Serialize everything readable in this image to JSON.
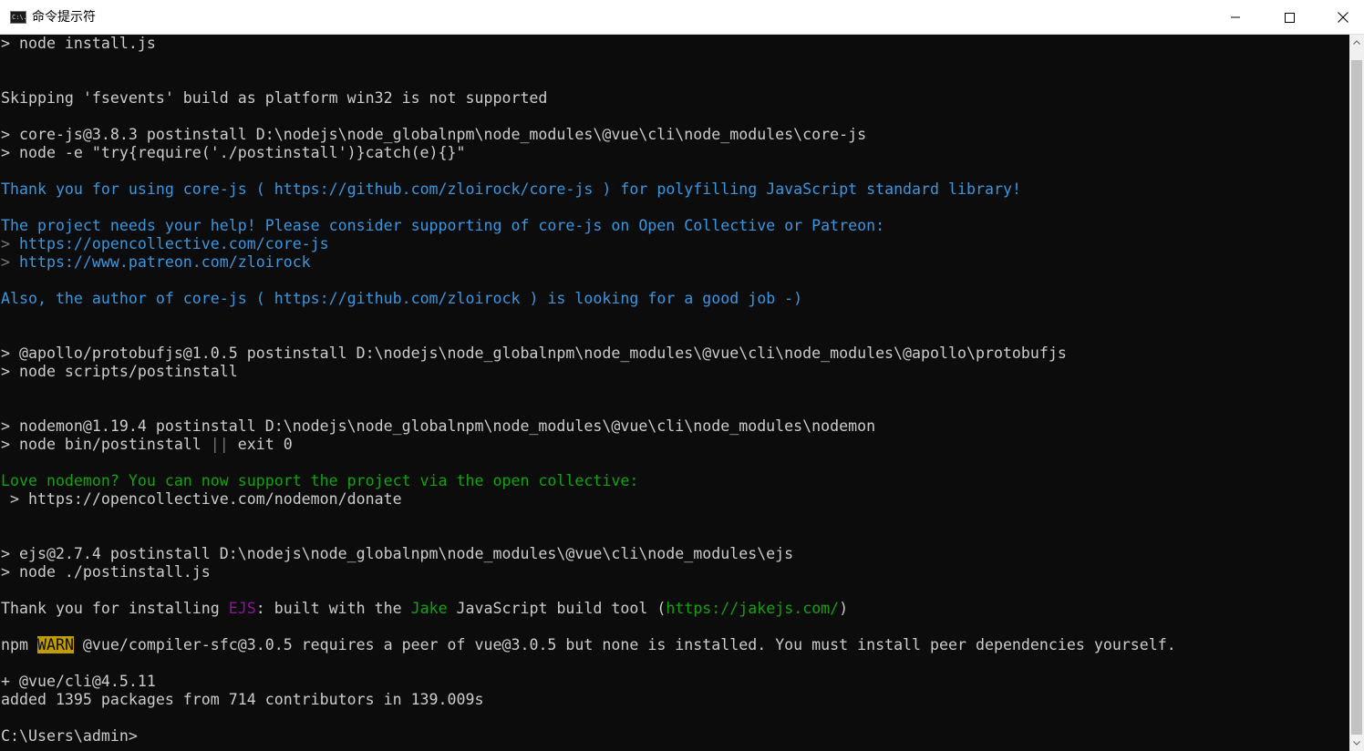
{
  "window": {
    "title": "命令提示符",
    "app_icon_text": "C:\\."
  },
  "colors": {
    "background": "#0c0c0c",
    "text": "#cccccc",
    "cyan": "#3a96dd",
    "green": "#13a10e",
    "magenta": "#881798",
    "warn_bg": "#c19c00"
  },
  "console": {
    "l1": "> node install.js",
    "l2": "Skipping 'fsevents' build as platform win32 is not supported",
    "l3": "> core-js@3.8.3 postinstall D:\\nodejs\\node_globalnpm\\node_modules\\@vue\\cli\\node_modules\\core-js",
    "l4": "> node -e \"try{require('./postinstall')}catch(e){}\"",
    "l5a": "Thank you for using core-js ( ",
    "l5b": "https://github.com/zloirock/core-js",
    "l5c": " ) for polyfilling JavaScript standard library!",
    "l6": "The project needs your help! Please consider supporting of core-js on Open Collective or Patreon:",
    "l7a": "> ",
    "l7b": "https://opencollective.com/core-js",
    "l8a": "> ",
    "l8b": "https://www.patreon.com/zloirock",
    "l9a": "Also, the author of core-js ( ",
    "l9b": "https://github.com/zloirock",
    "l9c": " ) is looking for a good job -)",
    "l10": "> @apollo/protobufjs@1.0.5 postinstall D:\\nodejs\\node_globalnpm\\node_modules\\@vue\\cli\\node_modules\\@apollo\\protobufjs",
    "l11": "> node scripts/postinstall",
    "l12": "> nodemon@1.19.4 postinstall D:\\nodejs\\node_globalnpm\\node_modules\\@vue\\cli\\node_modules\\nodemon",
    "l13a": "> node bin/postinstall ",
    "l13b": "||",
    "l13c": " exit 0",
    "l14": "Love nodemon? You can now support the project via the open collective:",
    "l15": " > https://opencollective.com/nodemon/donate",
    "l16": "> ejs@2.7.4 postinstall D:\\nodejs\\node_globalnpm\\node_modules\\@vue\\cli\\node_modules\\ejs",
    "l17": "> node ./postinstall.js",
    "l18a": "Thank you for installing ",
    "l18b": "EJS",
    "l18c": ": built with the ",
    "l18d": "Jake",
    "l18e": " JavaScript build tool (",
    "l18f": "https://jakejs.com/",
    "l18g": ")",
    "l19a": "npm ",
    "l19b": "WARN",
    "l19c": " @vue/compiler-sfc@3.0.5 requires a peer of vue@3.0.5 but none is installed. You must install peer dependencies yourself.",
    "l20": "+ @vue/cli@4.5.11",
    "l21": "added 1395 packages from 714 contributors in 139.009s",
    "prompt": "C:\\Users\\admin>"
  }
}
